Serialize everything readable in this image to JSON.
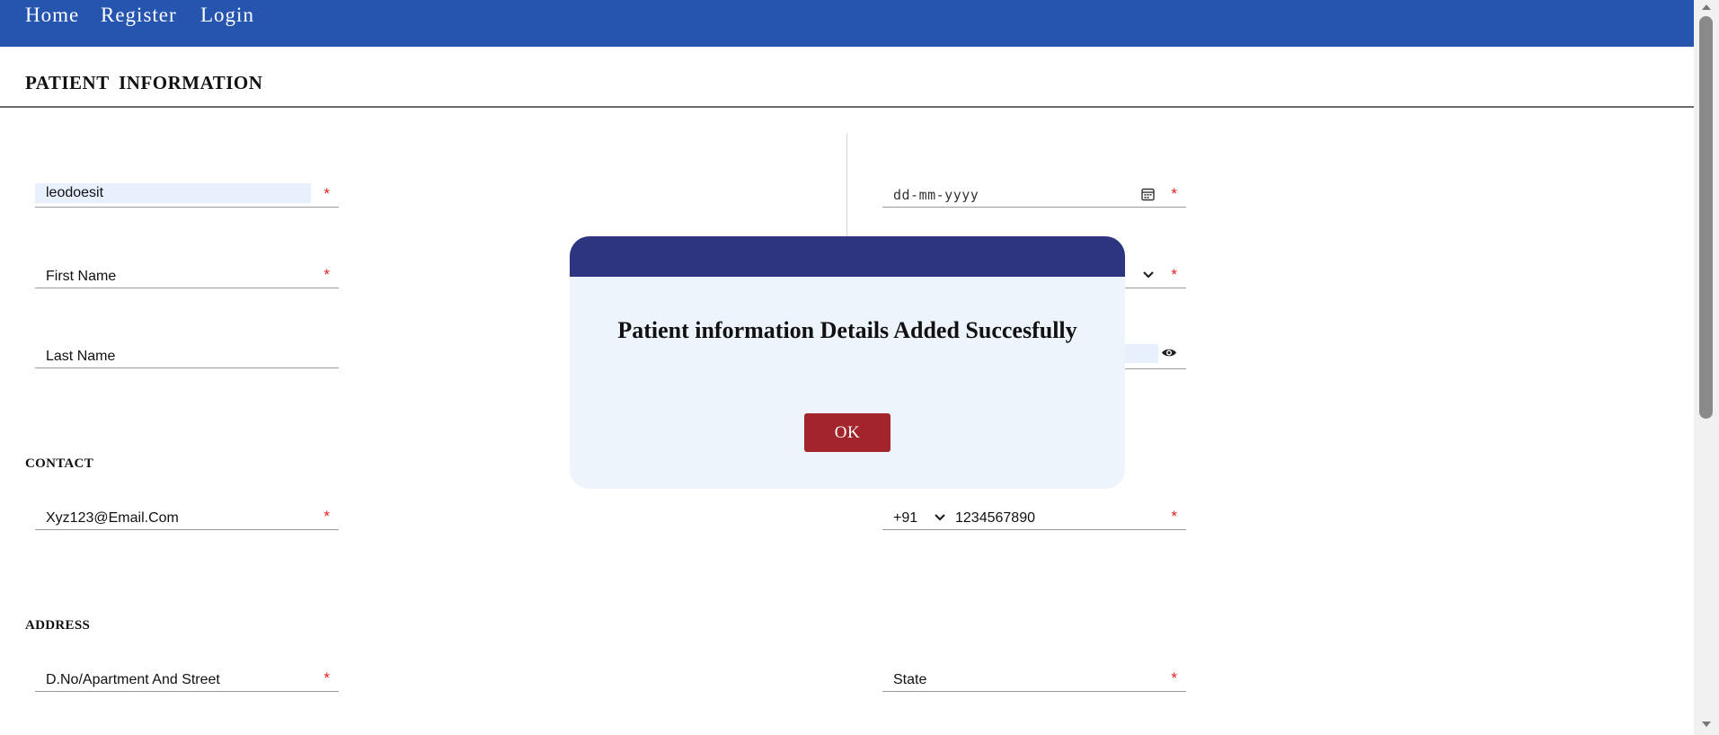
{
  "nav": {
    "items": [
      {
        "label": "Home"
      },
      {
        "label": "Register"
      },
      {
        "label": "Login"
      }
    ]
  },
  "page": {
    "title": "PATIENT  INFORMATION"
  },
  "form": {
    "username_value": "leodoesit",
    "dob_placeholder": "dd-mm-yyyy",
    "first_name_placeholder": "First Name",
    "last_name_placeholder": "Last Name",
    "required_mark": "*"
  },
  "contact": {
    "section_label": "CONTACT",
    "email_value": "Xyz123@Email.Com",
    "country_code": "+91",
    "phone_value": "1234567890"
  },
  "address": {
    "section_label": "ADDRESS",
    "street_placeholder": "D.No/Apartment And Street",
    "state_placeholder": "State"
  },
  "modal": {
    "message": "Patient information Details Added Succesfully",
    "ok_label": "OK"
  },
  "icons": {
    "calendar": "calendar-icon",
    "chevron": "chevron-down-icon",
    "eye": "eye-icon"
  },
  "colors": {
    "navbar": "#2655b0",
    "modal_header": "#2e3580",
    "modal_body": "#edf4fc",
    "ok_button": "#a3252b",
    "required": "#e02020",
    "autofill": "#e8f0fe"
  }
}
